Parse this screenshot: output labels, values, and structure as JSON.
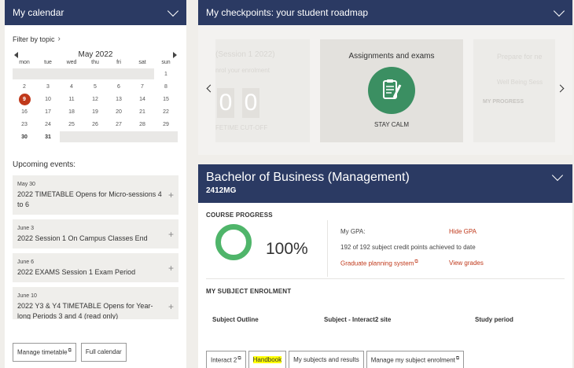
{
  "calendar": {
    "header": "My calendar",
    "filter_label": "Filter by topic",
    "month": "May 2022",
    "weekdays": [
      "mon",
      "tue",
      "wed",
      "thu",
      "fri",
      "sat",
      "sun"
    ],
    "weeks": [
      [
        "",
        "",
        "",
        "",
        "",
        "",
        "1"
      ],
      [
        "2",
        "3",
        "4",
        "5",
        "6",
        "7",
        "8"
      ],
      [
        "9",
        "10",
        "11",
        "12",
        "13",
        "14",
        "15"
      ],
      [
        "16",
        "17",
        "18",
        "19",
        "20",
        "21",
        "22"
      ],
      [
        "23",
        "24",
        "25",
        "26",
        "27",
        "28",
        "29"
      ],
      [
        "30",
        "31",
        "",
        "",
        "",
        "",
        ""
      ]
    ],
    "today": "9",
    "upcoming_label": "Upcoming events:",
    "events": [
      {
        "date": "May 30",
        "title": "2022 TIMETABLE Opens for Micro-sessions 4 to 6"
      },
      {
        "date": "June 3",
        "title": "2022 Session 1 On Campus Classes End"
      },
      {
        "date": "June 6",
        "title": "2022 EXAMS Session 1 Exam Period"
      },
      {
        "date": "June 10",
        "title": "2022 Y3 & Y4 TIMETABLE Opens for Year-long Periods 3 and 4 (read only)"
      }
    ],
    "manage_label": "Manage timetable",
    "full_label": "Full calendar"
  },
  "checkpoints": {
    "header": "My checkpoints: your student roadmap",
    "prev_card": {
      "title": "(Session 1 2022)",
      "subtitle": "nrol your enrolment",
      "digit1": "0",
      "digit2": "0",
      "footer": "FETIME CUT-OFF"
    },
    "current_card": {
      "title": "Assignments and exams",
      "icon": "clipboard-pen-icon",
      "label": "STAY CALM",
      "color": "#3b8f62"
    },
    "next_card": {
      "title": "Prepare for ne",
      "subtitle": "Well Being Sess",
      "footer": "MY PROGRESS"
    }
  },
  "degree": {
    "name": "Bachelor of Business (Management)",
    "code": "2412MG",
    "progress_title": "COURSE PROGRESS",
    "progress": "100%",
    "progress_fraction": 1.0,
    "gpa_label": "My GPA:",
    "hide_gpa": "Hide GPA",
    "credits_text": "192 of 192 subject credit points achieved to date",
    "grad_planning": "Graduate planning system",
    "view_grades": "View grades",
    "enrolment_title": "MY SUBJECT ENROLMENT",
    "columns": [
      "Subject Outline",
      "Subject - Interact2 site",
      "Study period"
    ],
    "tabs": [
      "Interact 2",
      "Handbook",
      "My subjects and results",
      "Manage my subject enrolment"
    ]
  },
  "colors": {
    "navy": "#2b3a63",
    "accent_red": "#c0391b",
    "green": "#4fb56a"
  }
}
